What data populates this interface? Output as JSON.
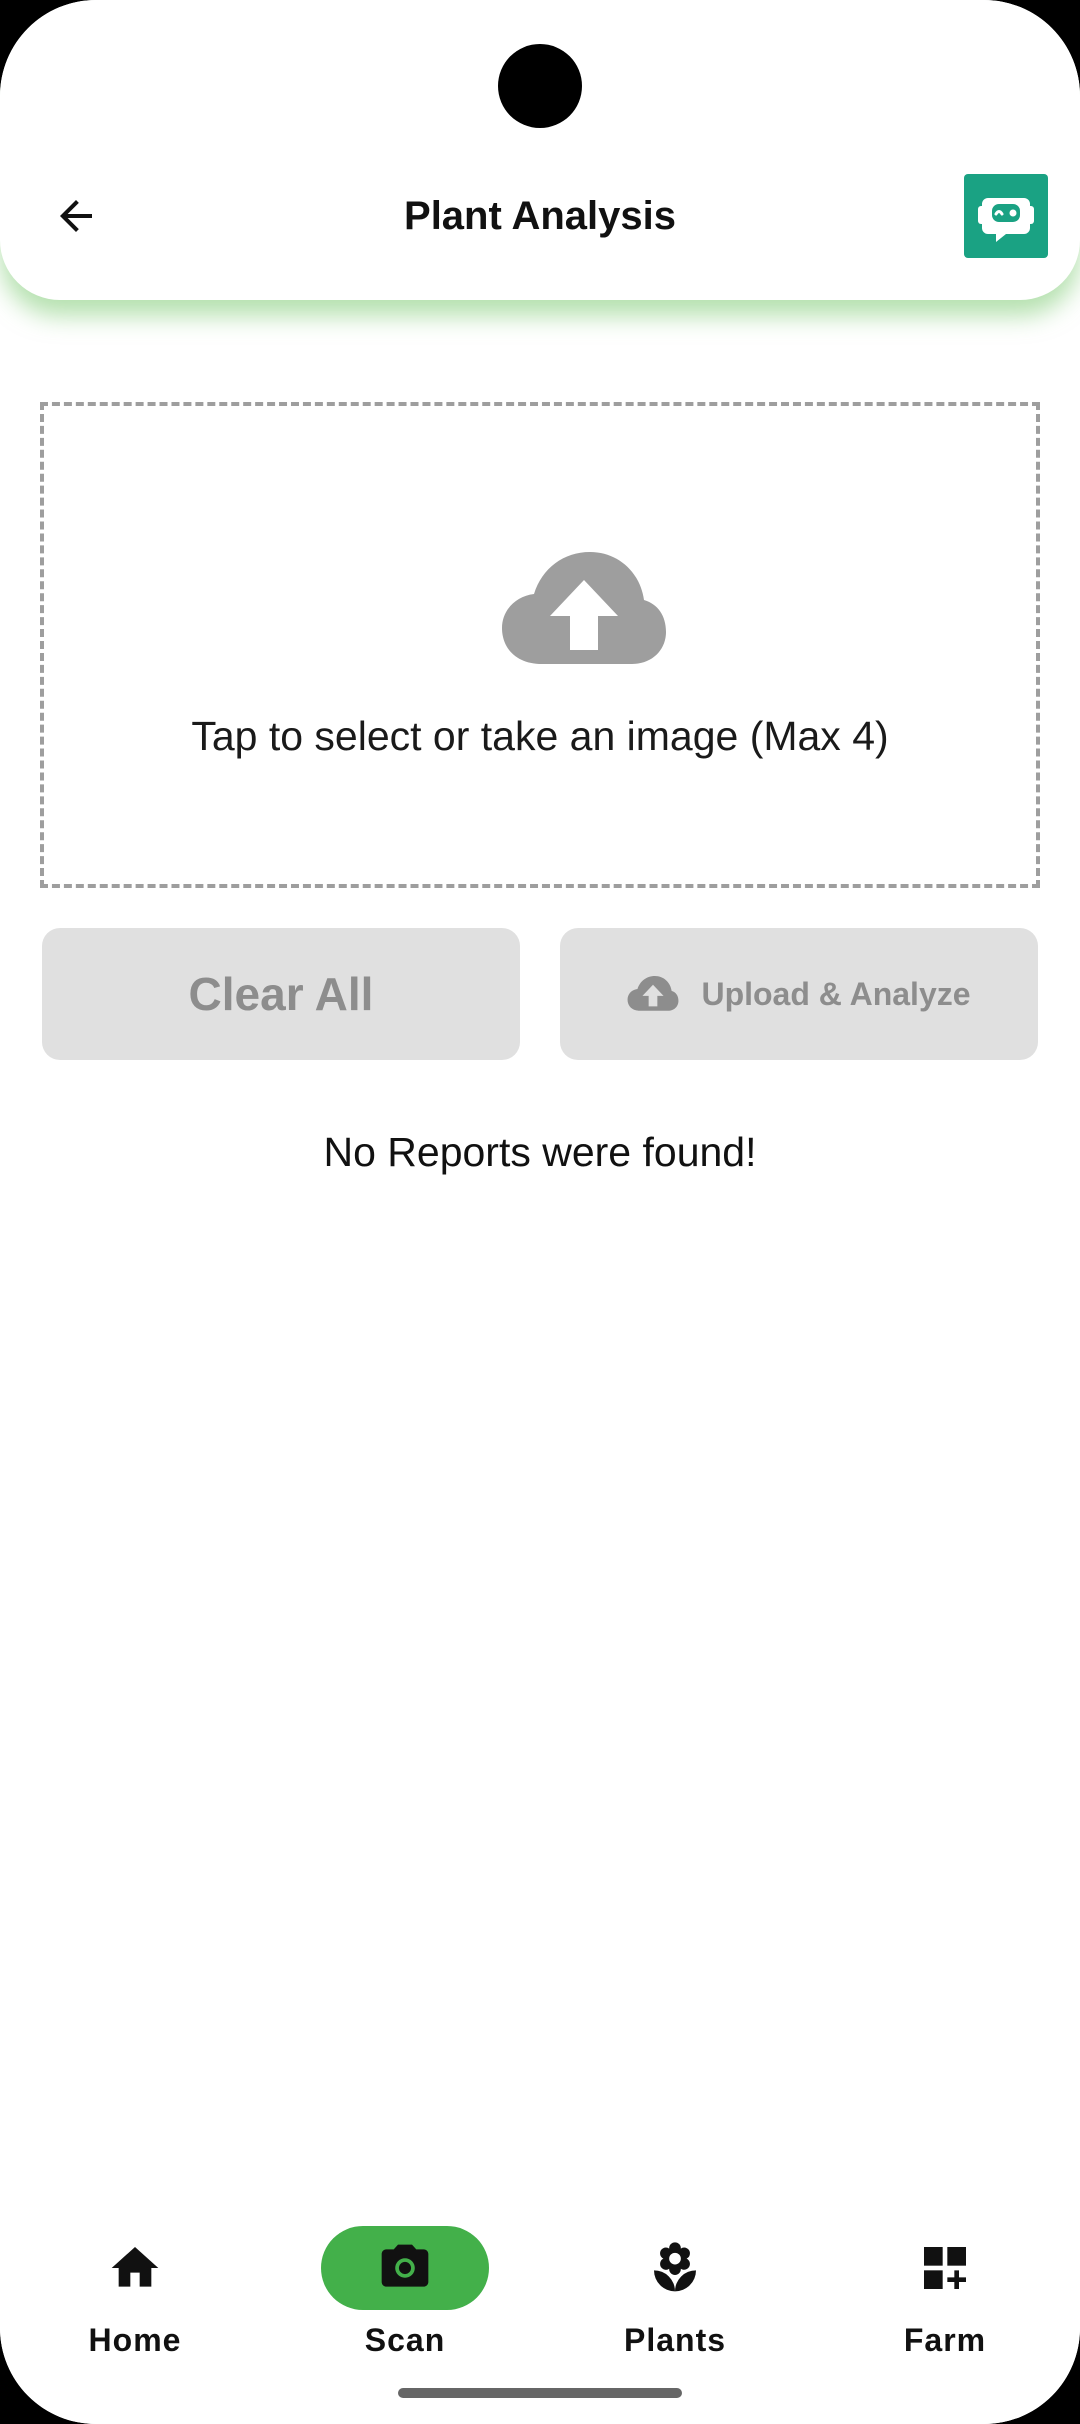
{
  "header": {
    "title": "Plant Analysis",
    "back_icon": "arrow-left-icon",
    "bot_icon": "robot-icon",
    "accent_color": "#1aa283"
  },
  "upload": {
    "icon": "cloud-upload-icon",
    "hint": "Tap to select or take an image (Max 4)"
  },
  "actions": {
    "clear_label": "Clear All",
    "upload_label": "Upload & Analyze",
    "upload_icon": "cloud-upload-icon"
  },
  "reports": {
    "empty_message": "No Reports were found!"
  },
  "bottom_nav": {
    "active_color": "#43b04a",
    "items": [
      {
        "label": "Home",
        "icon": "home-icon",
        "active": false
      },
      {
        "label": "Scan",
        "icon": "camera-icon",
        "active": true
      },
      {
        "label": "Plants",
        "icon": "flower-icon",
        "active": false
      },
      {
        "label": "Farm",
        "icon": "grid-add-icon",
        "active": false
      }
    ]
  }
}
